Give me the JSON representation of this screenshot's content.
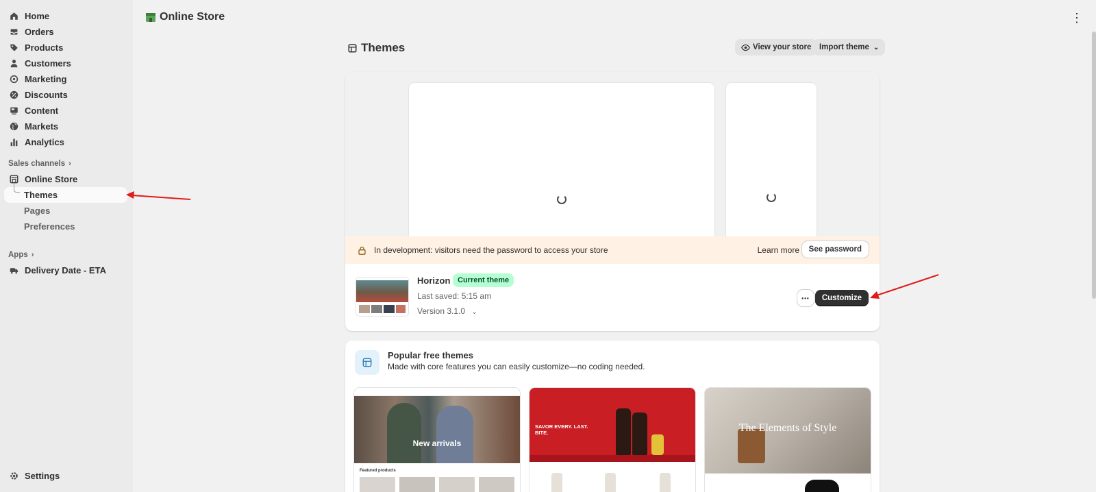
{
  "sidebar": {
    "items": [
      {
        "label": "Home",
        "icon": "home-icon"
      },
      {
        "label": "Orders",
        "icon": "orders-icon"
      },
      {
        "label": "Products",
        "icon": "tag-icon"
      },
      {
        "label": "Customers",
        "icon": "person-icon"
      },
      {
        "label": "Marketing",
        "icon": "target-icon"
      },
      {
        "label": "Discounts",
        "icon": "discount-icon"
      },
      {
        "label": "Content",
        "icon": "content-icon"
      },
      {
        "label": "Markets",
        "icon": "globe-icon"
      },
      {
        "label": "Analytics",
        "icon": "bar-chart-icon"
      }
    ],
    "sales_channels_label": "Sales channels",
    "online_store_label": "Online Store",
    "sub_items": [
      {
        "label": "Themes"
      },
      {
        "label": "Pages"
      },
      {
        "label": "Preferences"
      }
    ],
    "apps_label": "Apps",
    "app_item_label": "Delivery Date - ETA",
    "settings_label": "Settings"
  },
  "topbar": {
    "title": "Online Store"
  },
  "page": {
    "title": "Themes",
    "view_store_label": "View your store",
    "import_theme_label": "Import theme"
  },
  "theme_card": {
    "dev_banner_text": "In development: visitors need the password to access your store",
    "learn_more_label": "Learn more",
    "see_password_label": "See password",
    "theme_name": "Horizon",
    "badge_label": "Current theme",
    "last_saved": "Last saved: 5:15 am",
    "version": "Version 3.1.0",
    "more_label": "•••",
    "customize_label": "Customize"
  },
  "popular": {
    "title": "Popular free themes",
    "subtitle": "Made with core features you can easily customize—no coding needed.",
    "themes": [
      {
        "headline": "New arrivals",
        "sub": "Featured products"
      },
      {
        "headline": "SAVOR EVERY. LAST. BITE."
      },
      {
        "headline": "The Elements of Style"
      }
    ]
  },
  "colors": {
    "accent_dark": "#303030",
    "badge_green": "#b4fed2",
    "banner_orange": "#fff1e3",
    "annotation_red": "#e01b1b"
  }
}
